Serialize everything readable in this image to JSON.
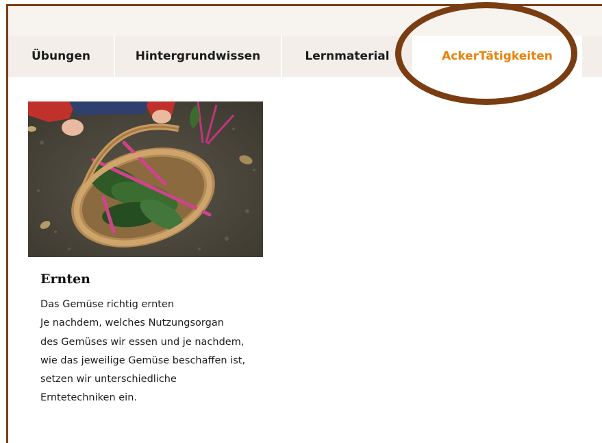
{
  "tabs": [
    {
      "label": "Übungen",
      "active": false
    },
    {
      "label": "Hintergrundwissen",
      "active": false
    },
    {
      "label": "Lernmaterial",
      "active": false
    },
    {
      "label": "AckerTätigkeiten",
      "active": true
    }
  ],
  "card": {
    "title": "Ernten",
    "lines": [
      "Das Gemüse richtig ernten",
      "Je nachdem, welches Nutzungsorgan",
      "des Gemüses wir essen und je nachdem,",
      "wie das jeweilige Gemüse beschaffen ist,",
      "setzen wir unterschiedliche",
      "Erntetechniken ein."
    ]
  },
  "colors": {
    "accent": "#e8830c",
    "frame": "#7a3d12",
    "tabbar_bg": "#f3eee9"
  }
}
